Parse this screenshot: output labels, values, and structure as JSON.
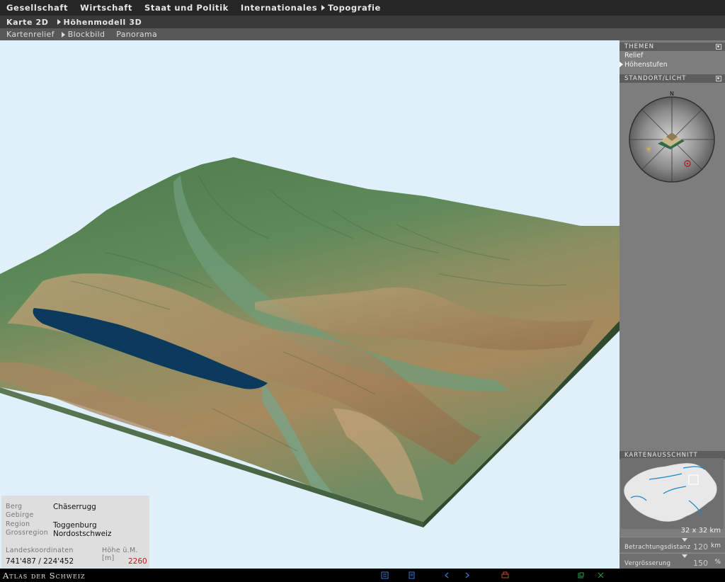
{
  "nav_primary": [
    "Gesellschaft",
    "Wirtschaft",
    "Staat und Politik",
    "Internationales",
    "Topografie"
  ],
  "nav_secondary": [
    "Karte 2D",
    "Höhenmodell 3D"
  ],
  "nav_tertiary": [
    "Kartenrelief",
    "Blockbild",
    "Panorama"
  ],
  "info": {
    "berg_label": "Berg",
    "berg_value": "Chäserrugg",
    "gebirge_label": "Gebirge",
    "gebirge_value": "",
    "region_label": "Region",
    "region_value": "Toggenburg",
    "grossregion_label": "Grossregion",
    "grossregion_value": "Nordostschweiz",
    "coord_label": "Landeskoordinaten",
    "coord_value": "741'487 / 224'452",
    "height_label": "Höhe ü.M. [m]",
    "height_value": "2260"
  },
  "panel": {
    "themen_title": "THEMEN",
    "themen_items": [
      "Relief",
      "Höhenstufen"
    ],
    "standort_title": "STANDORT/LICHT",
    "compass_north": "N",
    "karten_title": "KARTENAUSSCHNITT",
    "map_size": "32 x 32 km",
    "distance_label": "Betrachtungsdistanz",
    "distance_value": "120",
    "distance_unit": "km",
    "zoom_label": "Vergrösserung",
    "zoom_value": "150",
    "zoom_unit": "%"
  },
  "brand": "Atlas der Schweiz",
  "colors": {
    "accent_red": "#b22020",
    "lake": "#0b3a5c",
    "sky": "#dff0fb"
  },
  "bottom_icons": [
    "list-icon",
    "document-icon",
    "arrow-left-icon",
    "arrow-right-icon",
    "print-icon",
    "page-icon",
    "close-icon"
  ]
}
